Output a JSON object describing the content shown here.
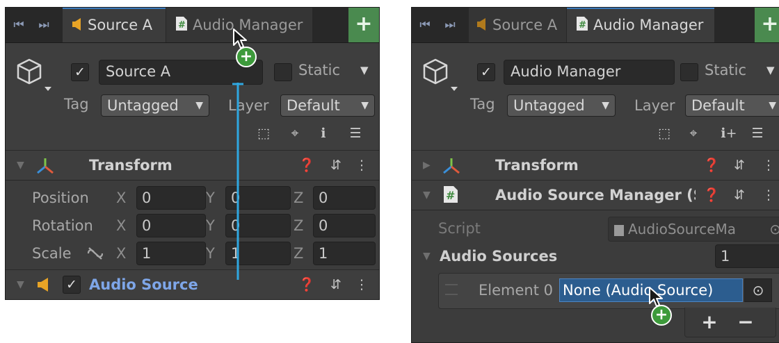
{
  "left": {
    "tabs": [
      {
        "label": "Source A",
        "icon": "audio-source-icon",
        "active": true
      },
      {
        "label": "Audio Manager",
        "icon": "script-icon",
        "active": false
      }
    ],
    "header": {
      "name": "Source A",
      "active_checked": true,
      "static_label": "Static",
      "tag_label": "Tag",
      "tag_value": "Untagged",
      "layer_label": "Layer",
      "layer_value": "Default"
    },
    "transform": {
      "title": "Transform",
      "rows": [
        {
          "label": "Position",
          "x": "0",
          "y": "0",
          "z": "0"
        },
        {
          "label": "Rotation",
          "x": "0",
          "y": "0",
          "z": "0"
        },
        {
          "label": "Scale",
          "x": "1",
          "y": "1",
          "z": "1"
        }
      ],
      "axis_x": "X",
      "axis_y": "Y",
      "axis_z": "Z"
    },
    "audio_source": {
      "title": "Audio Source",
      "enabled": true
    }
  },
  "right": {
    "tabs": [
      {
        "label": "Source A",
        "icon": "audio-source-icon",
        "active": false
      },
      {
        "label": "Audio Manager",
        "icon": "script-icon",
        "active": true
      }
    ],
    "header": {
      "name": "Audio Manager",
      "active_checked": true,
      "static_label": "Static",
      "tag_label": "Tag",
      "tag_value": "Untagged",
      "layer_label": "Layer",
      "layer_value": "Default"
    },
    "transform": {
      "title": "Transform"
    },
    "manager": {
      "title": "Audio Source Manager (S",
      "script_label": "Script",
      "script_value": "AudioSourceMa",
      "sources_label": "Audio Sources",
      "sources_count": "1",
      "element_label": "Element 0",
      "element_value": "None (Audio Source)"
    }
  },
  "colors": {
    "panel_bg": "#3c3c3c",
    "tab_active_accent": "#3a79bb",
    "add_button_green": "#4a8a4f",
    "drag_line_blue": "#2fa7e0",
    "selected_field_blue": "#2c5d8f",
    "audio_source_title": "#7ea6e8"
  }
}
